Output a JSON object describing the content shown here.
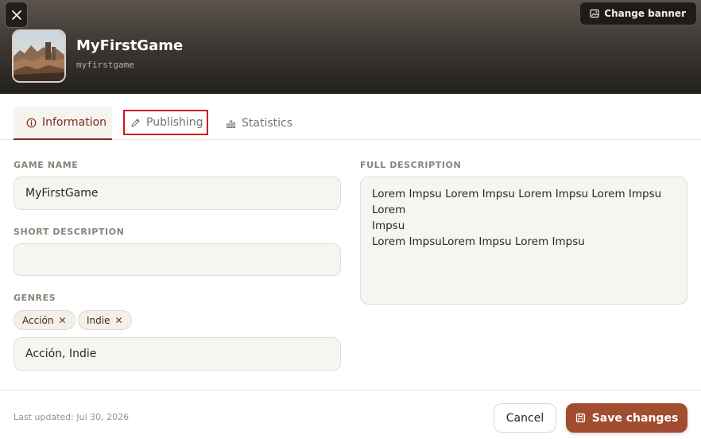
{
  "banner": {
    "close_icon": "close-icon",
    "change_banner_label": "Change banner",
    "change_banner_icon": "image-edit-icon"
  },
  "game": {
    "title": "MyFirstGame",
    "slug": "myfirstgame"
  },
  "tabs": [
    {
      "label": "Information",
      "icon": "info-icon",
      "active": true
    },
    {
      "label": "Publishing",
      "icon": "pencil-tag-icon",
      "active": false
    },
    {
      "label": "Statistics",
      "icon": "bar-chart-icon",
      "active": false
    }
  ],
  "form": {
    "game_name": {
      "label": "GAME NAME",
      "value": "MyFirstGame"
    },
    "short_description": {
      "label": "SHORT DESCRIPTION",
      "value": ""
    },
    "genres": {
      "label": "GENRES",
      "chips": [
        "Acción",
        "Indie"
      ],
      "input_value": "Acción, Indie"
    },
    "full_description": {
      "label": "FULL DESCRIPTION",
      "lines": [
        "Lorem Impsu Lorem Impsu Lorem Impsu Lorem Impsu Lorem",
        "Impsu",
        "Lorem ImpsuLorem Impsu Lorem Impsu"
      ]
    }
  },
  "footer": {
    "last_updated": "Last updated: Jul 30, 2026",
    "cancel_label": "Cancel",
    "save_label": "Save changes",
    "save_icon": "save-icon"
  },
  "colors": {
    "accent": "#a24c30",
    "active_tab": "#7a2e1a",
    "highlight_box": "#d4171b"
  }
}
